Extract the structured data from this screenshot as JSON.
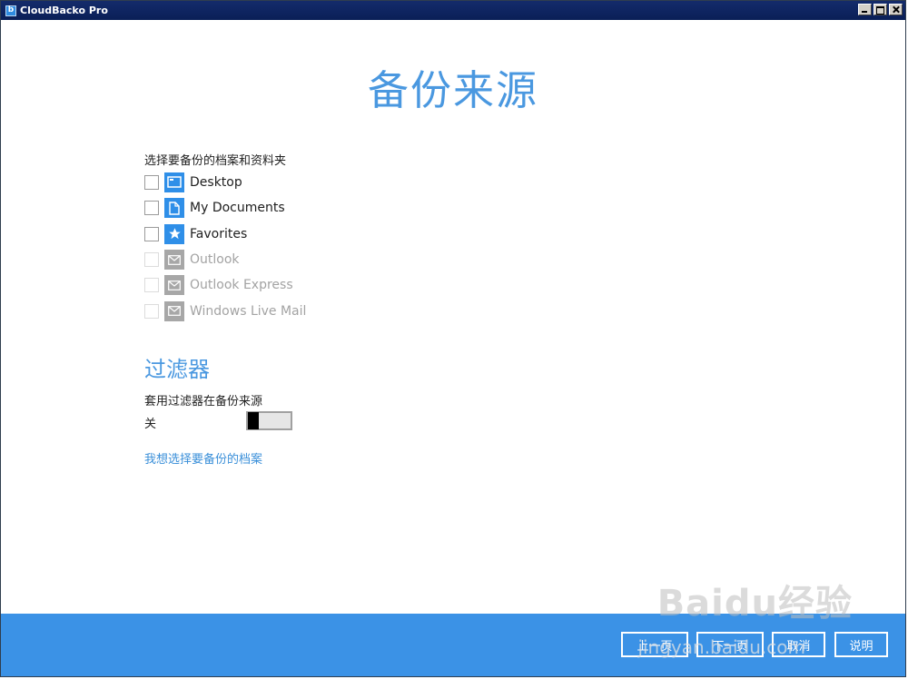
{
  "window": {
    "title": "CloudBacko Pro"
  },
  "page": {
    "title": "备份来源"
  },
  "sources": {
    "label": "选择要备份的档案和资料夹",
    "items": [
      {
        "label": "Desktop",
        "icon": "desktop-icon",
        "checked": false,
        "enabled": true
      },
      {
        "label": "My Documents",
        "icon": "document-icon",
        "checked": false,
        "enabled": true
      },
      {
        "label": "Favorites",
        "icon": "star-icon",
        "checked": false,
        "enabled": true
      },
      {
        "label": "Outlook",
        "icon": "mail-icon",
        "checked": false,
        "enabled": false
      },
      {
        "label": "Outlook Express",
        "icon": "mail-icon",
        "checked": false,
        "enabled": false
      },
      {
        "label": "Windows Live Mail",
        "icon": "mail-icon",
        "checked": false,
        "enabled": false
      }
    ]
  },
  "filter": {
    "title": "过滤器",
    "description": "套用过滤器在备份来源",
    "state": "关",
    "enabled": false
  },
  "link": {
    "select_files": "我想选择要备份的档案"
  },
  "footer": {
    "prev": "上一页",
    "next": "下一页",
    "cancel": "取消",
    "help": "说明"
  },
  "watermark": {
    "text": "Baidu经验",
    "sub": "jingyan.baidu.com"
  },
  "colors": {
    "accent": "#3b92e6",
    "title": "#4a98e0",
    "titlebar": "#0a1f57",
    "icon_active": "#2f8fe8",
    "icon_disabled": "#a7a7a7"
  }
}
